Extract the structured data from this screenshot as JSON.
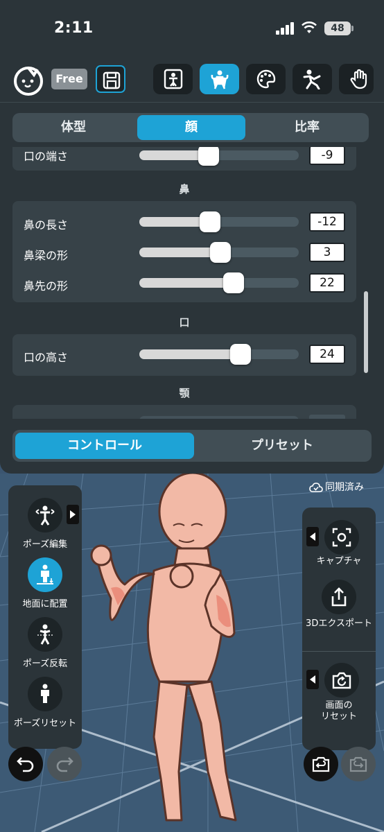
{
  "status_bar": {
    "time": "2:11",
    "battery": "48"
  },
  "header": {
    "free_badge": "Free",
    "modes": [
      {
        "name": "figure-mode",
        "icon": "figure-frame-icon",
        "active": false
      },
      {
        "name": "body-mode",
        "icon": "muscle-icon",
        "active": true
      },
      {
        "name": "color-mode",
        "icon": "palette-icon",
        "active": false
      },
      {
        "name": "pose-mode",
        "icon": "running-pose-icon",
        "active": false
      },
      {
        "name": "hand-mode",
        "icon": "hand-icon",
        "active": false
      }
    ]
  },
  "panel": {
    "tabs": [
      {
        "label": "体型",
        "active": false
      },
      {
        "label": "顔",
        "active": true
      },
      {
        "label": "比率",
        "active": false
      }
    ],
    "partial_row": {
      "label": "口の端さ",
      "value": "-9",
      "fraction": 0.42
    },
    "sections": [
      {
        "title": "鼻",
        "rows": [
          {
            "label": "鼻の長さ",
            "value": "-12",
            "fraction": 0.44
          },
          {
            "label": "鼻梁の形",
            "value": "3",
            "fraction": 0.51
          },
          {
            "label": "鼻先の形",
            "value": "22",
            "fraction": 0.59
          }
        ]
      },
      {
        "title": "口",
        "rows": [
          {
            "label": "口の高さ",
            "value": "24",
            "fraction": 0.6
          }
        ]
      },
      {
        "title": "顎",
        "rows": []
      }
    ],
    "bottom_tabs": [
      {
        "label": "コントロール",
        "active": true
      },
      {
        "label": "プリセット",
        "active": false
      }
    ]
  },
  "viewport": {
    "sync_status": "同期済み",
    "left_tools": [
      {
        "label": "ポーズ編集",
        "icon": "pose-edit-icon",
        "active": false
      },
      {
        "label": "地面に配置",
        "icon": "place-on-ground-icon",
        "active": true
      },
      {
        "label": "ポーズ反転",
        "icon": "pose-flip-icon",
        "active": false
      },
      {
        "label": "ポーズリセット",
        "icon": "pose-reset-icon",
        "active": false
      }
    ],
    "right_tools": [
      {
        "label": "キャプチャ",
        "icon": "capture-icon"
      },
      {
        "label": "3Dエクスポート",
        "icon": "export-icon"
      },
      {
        "label": "画面の\nリセット",
        "icon": "camera-reset-icon"
      }
    ]
  },
  "colors": {
    "accent": "#1ea3d6",
    "panel": "#2b3439",
    "grid_bg": "#3d5a75"
  }
}
